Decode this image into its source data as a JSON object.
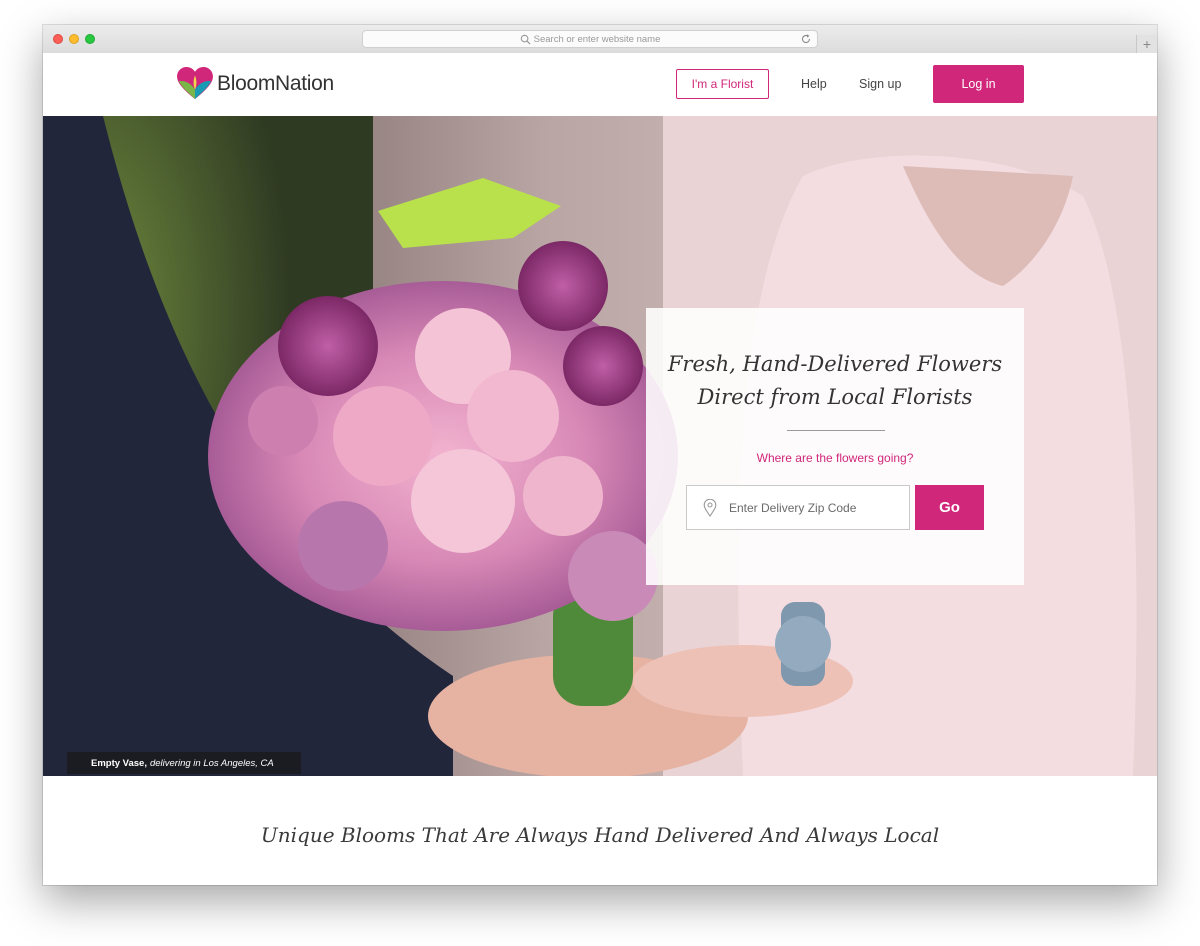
{
  "browser": {
    "url_placeholder": "Search or enter website name",
    "new_tab_glyph": "+"
  },
  "header": {
    "logo_text": "BloomNation",
    "florist_button": "I'm a Florist",
    "help_link": "Help",
    "signup_link": "Sign up",
    "login_button": "Log in"
  },
  "hero": {
    "headline_line1": "Fresh, Hand-Delivered Flowers",
    "headline_line2": "Direct from Local Florists",
    "question": "Where are the flowers going?",
    "zip_placeholder": "Enter Delivery Zip Code",
    "go_button": "Go",
    "caption_name": "Empty Vase,",
    "caption_detail": "delivering in Los Angeles, CA"
  },
  "tagline": "Unique Blooms That Are Always Hand Delivered And Always Local",
  "colors": {
    "brand_pink": "#d1277a",
    "text_dark": "#333333"
  }
}
